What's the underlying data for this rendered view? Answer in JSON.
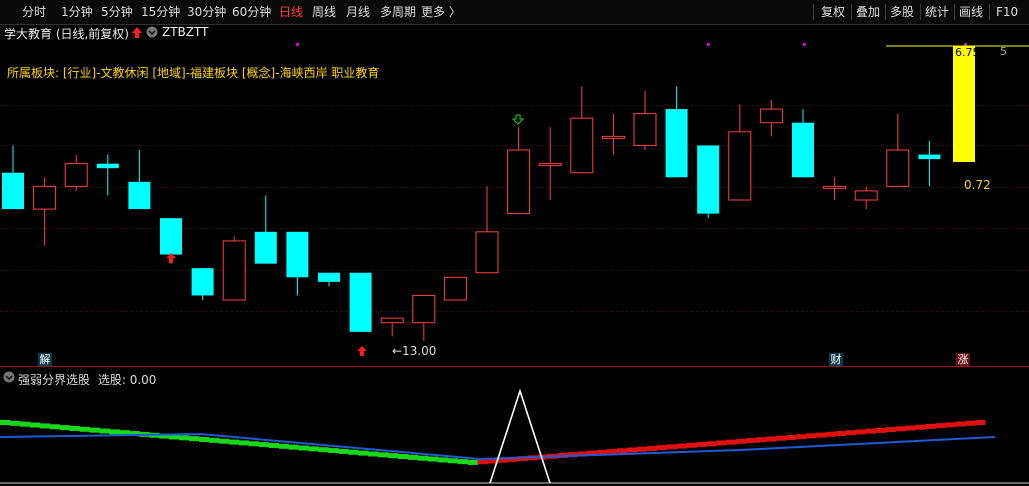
{
  "toolbar": {
    "periods": [
      "分时",
      "1分钟",
      "5分钟",
      "15分钟",
      "30分钟",
      "60分钟",
      "日线",
      "周线",
      "月线",
      "多周期",
      "更多 〉"
    ],
    "active": "日线",
    "right_buttons": [
      "复权",
      "叠加",
      "多股",
      "统计",
      "画线",
      "F10"
    ]
  },
  "header": {
    "title": "学大教育 (日线,前复权)",
    "code": "ZTBZTT"
  },
  "board_info": "所属板块: [行业]-文教休闲 [地域]-福建板块 [概念]-海峡西岸 职业教育",
  "labels": {
    "low_price": "←13.00",
    "last_value": "0.72",
    "top_right": "6.750",
    "top_right_tail": "5"
  },
  "signals": {
    "left": "解",
    "mid": "财",
    "right": "涨"
  },
  "indicator": {
    "title": "强弱分界选股",
    "value_text": "选股: 0.00"
  },
  "colors": {
    "up": "#ff4040",
    "down": "#00ffff",
    "green": "#17d917",
    "red": "#e01010",
    "blue": "#1e5bd6",
    "yellow": "#ffff00"
  },
  "chart_data": {
    "type": "candlestick",
    "candles": [
      {
        "o": 15.9,
        "h": 16.5,
        "l": 15.1,
        "c": 15.1
      },
      {
        "o": 15.1,
        "h": 15.8,
        "l": 14.3,
        "c": 15.6
      },
      {
        "o": 15.6,
        "h": 16.3,
        "l": 15.5,
        "c": 16.1
      },
      {
        "o": 16.1,
        "h": 16.3,
        "l": 15.4,
        "c": 16.0
      },
      {
        "o": 15.7,
        "h": 16.4,
        "l": 15.1,
        "c": 15.1
      },
      {
        "o": 14.9,
        "h": 14.9,
        "l": 13.9,
        "c": 14.1
      },
      {
        "o": 13.8,
        "h": 13.8,
        "l": 13.1,
        "c": 13.2
      },
      {
        "o": 13.1,
        "h": 14.5,
        "l": 13.1,
        "c": 14.4
      },
      {
        "o": 14.6,
        "h": 15.4,
        "l": 13.9,
        "c": 13.9
      },
      {
        "o": 14.6,
        "h": 14.6,
        "l": 13.2,
        "c": 13.6
      },
      {
        "o": 13.7,
        "h": 13.7,
        "l": 13.4,
        "c": 13.5
      },
      {
        "o": 13.7,
        "h": 13.7,
        "l": 12.4,
        "c": 12.4
      },
      {
        "o": 12.6,
        "h": 12.7,
        "l": 12.3,
        "c": 12.7
      },
      {
        "o": 12.6,
        "h": 13.2,
        "l": 12.2,
        "c": 13.2
      },
      {
        "o": 13.1,
        "h": 13.6,
        "l": 13.1,
        "c": 13.6
      },
      {
        "o": 13.7,
        "h": 15.6,
        "l": 13.7,
        "c": 14.6
      },
      {
        "o": 15.0,
        "h": 16.9,
        "l": 15.0,
        "c": 16.4
      },
      {
        "o": 16.1,
        "h": 16.9,
        "l": 15.3,
        "c": 16.1
      },
      {
        "o": 15.9,
        "h": 17.8,
        "l": 15.9,
        "c": 17.1
      },
      {
        "o": 16.7,
        "h": 17.2,
        "l": 16.3,
        "c": 16.7
      },
      {
        "o": 16.5,
        "h": 17.7,
        "l": 16.4,
        "c": 17.2
      },
      {
        "o": 17.3,
        "h": 17.8,
        "l": 15.8,
        "c": 15.8
      },
      {
        "o": 16.5,
        "h": 16.5,
        "l": 14.9,
        "c": 15.0
      },
      {
        "o": 15.3,
        "h": 17.4,
        "l": 15.3,
        "c": 16.8
      },
      {
        "o": 17.0,
        "h": 17.5,
        "l": 16.7,
        "c": 17.3
      },
      {
        "o": 17.0,
        "h": 17.3,
        "l": 15.8,
        "c": 15.8
      },
      {
        "o": 15.6,
        "h": 15.8,
        "l": 15.3,
        "c": 15.6
      },
      {
        "o": 15.3,
        "h": 15.6,
        "l": 15.1,
        "c": 15.5
      },
      {
        "o": 15.6,
        "h": 17.2,
        "l": 15.6,
        "c": 16.4
      },
      {
        "o": 16.3,
        "h": 16.6,
        "l": 15.6,
        "c": 16.2
      }
    ],
    "price_range": [
      12.0,
      18.6
    ],
    "min_price_label": 13.0,
    "volume_bar_value": 0.72,
    "indicator": {
      "name": "强弱分界选股",
      "value": 0.0,
      "signal_peak_index": 16
    }
  }
}
